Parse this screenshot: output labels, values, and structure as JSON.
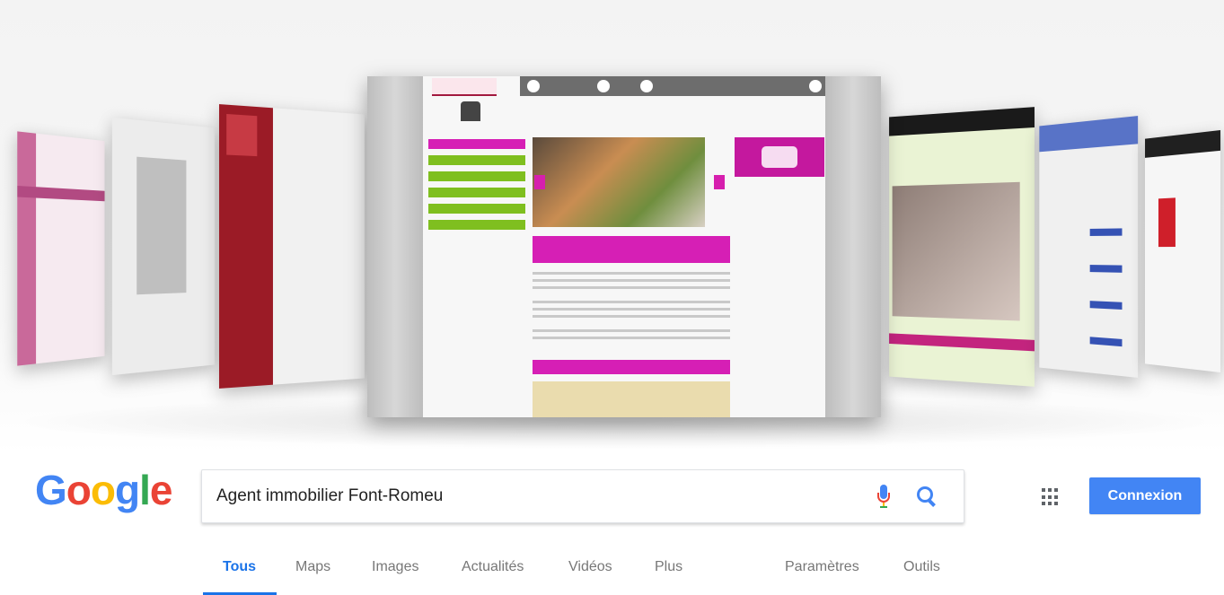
{
  "search": {
    "query": "Agent immobilier Font-Romeu"
  },
  "logo": {
    "letters": [
      "G",
      "o",
      "o",
      "g",
      "l",
      "e"
    ]
  },
  "header": {
    "signin_label": "Connexion",
    "apps_icon": "apps-grid-icon",
    "mic_icon": "microphone-icon",
    "search_icon": "search-icon"
  },
  "tabs": [
    {
      "label": "Tous",
      "active": true
    },
    {
      "label": "Maps",
      "active": false
    },
    {
      "label": "Images",
      "active": false
    },
    {
      "label": "Actualités",
      "active": false
    },
    {
      "label": "Vidéos",
      "active": false
    },
    {
      "label": "Plus",
      "active": false
    },
    {
      "label": "Paramètres",
      "active": false
    },
    {
      "label": "Outils",
      "active": false
    }
  ],
  "colors": {
    "google_blue": "#4285f4",
    "google_red": "#ea4335",
    "google_yellow": "#fbbc05",
    "google_green": "#34a853",
    "active_tab": "#1a73e8",
    "mockup_magenta": "#d61fb5"
  }
}
